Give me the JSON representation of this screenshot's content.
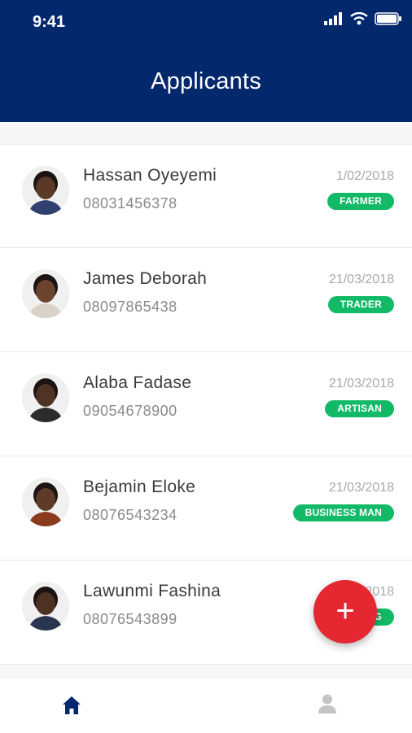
{
  "status_bar": {
    "time": "9:41"
  },
  "header": {
    "title": "Applicants"
  },
  "applicants": [
    {
      "name": "Hassan Oyeyemi",
      "phone": "08031456378",
      "date": "1/02/2018",
      "occupation": "FARMER",
      "skin": "#5a3a26",
      "shirt": "#2f3f6e"
    },
    {
      "name": "James Deborah",
      "phone": "08097865438",
      "date": "21/03/2018",
      "occupation": "TRADER",
      "skin": "#6b4430",
      "shirt": "#d9d2c8"
    },
    {
      "name": "Alaba Fadase",
      "phone": "09054678900",
      "date": "21/03/2018",
      "occupation": "ARTISAN",
      "skin": "#4f3325",
      "shirt": "#2b2b2b"
    },
    {
      "name": "Bejamin Eloke",
      "phone": "08076543234",
      "date": "21/03/2018",
      "occupation": "BUSINESS MAN",
      "skin": "#5e3b29",
      "shirt": "#8a3a1d"
    },
    {
      "name": "Lawunmi Fashina",
      "phone": "08076543899",
      "date": "21/03/2018",
      "occupation": "FARMING",
      "skin": "#4d3224",
      "shirt": "#2a3550"
    }
  ],
  "fab": {
    "label": "+"
  },
  "colors": {
    "header": "#03286b",
    "badge": "#12b966",
    "fab": "#e52731"
  },
  "icons": {
    "home": "home-icon",
    "profile": "person-icon"
  }
}
